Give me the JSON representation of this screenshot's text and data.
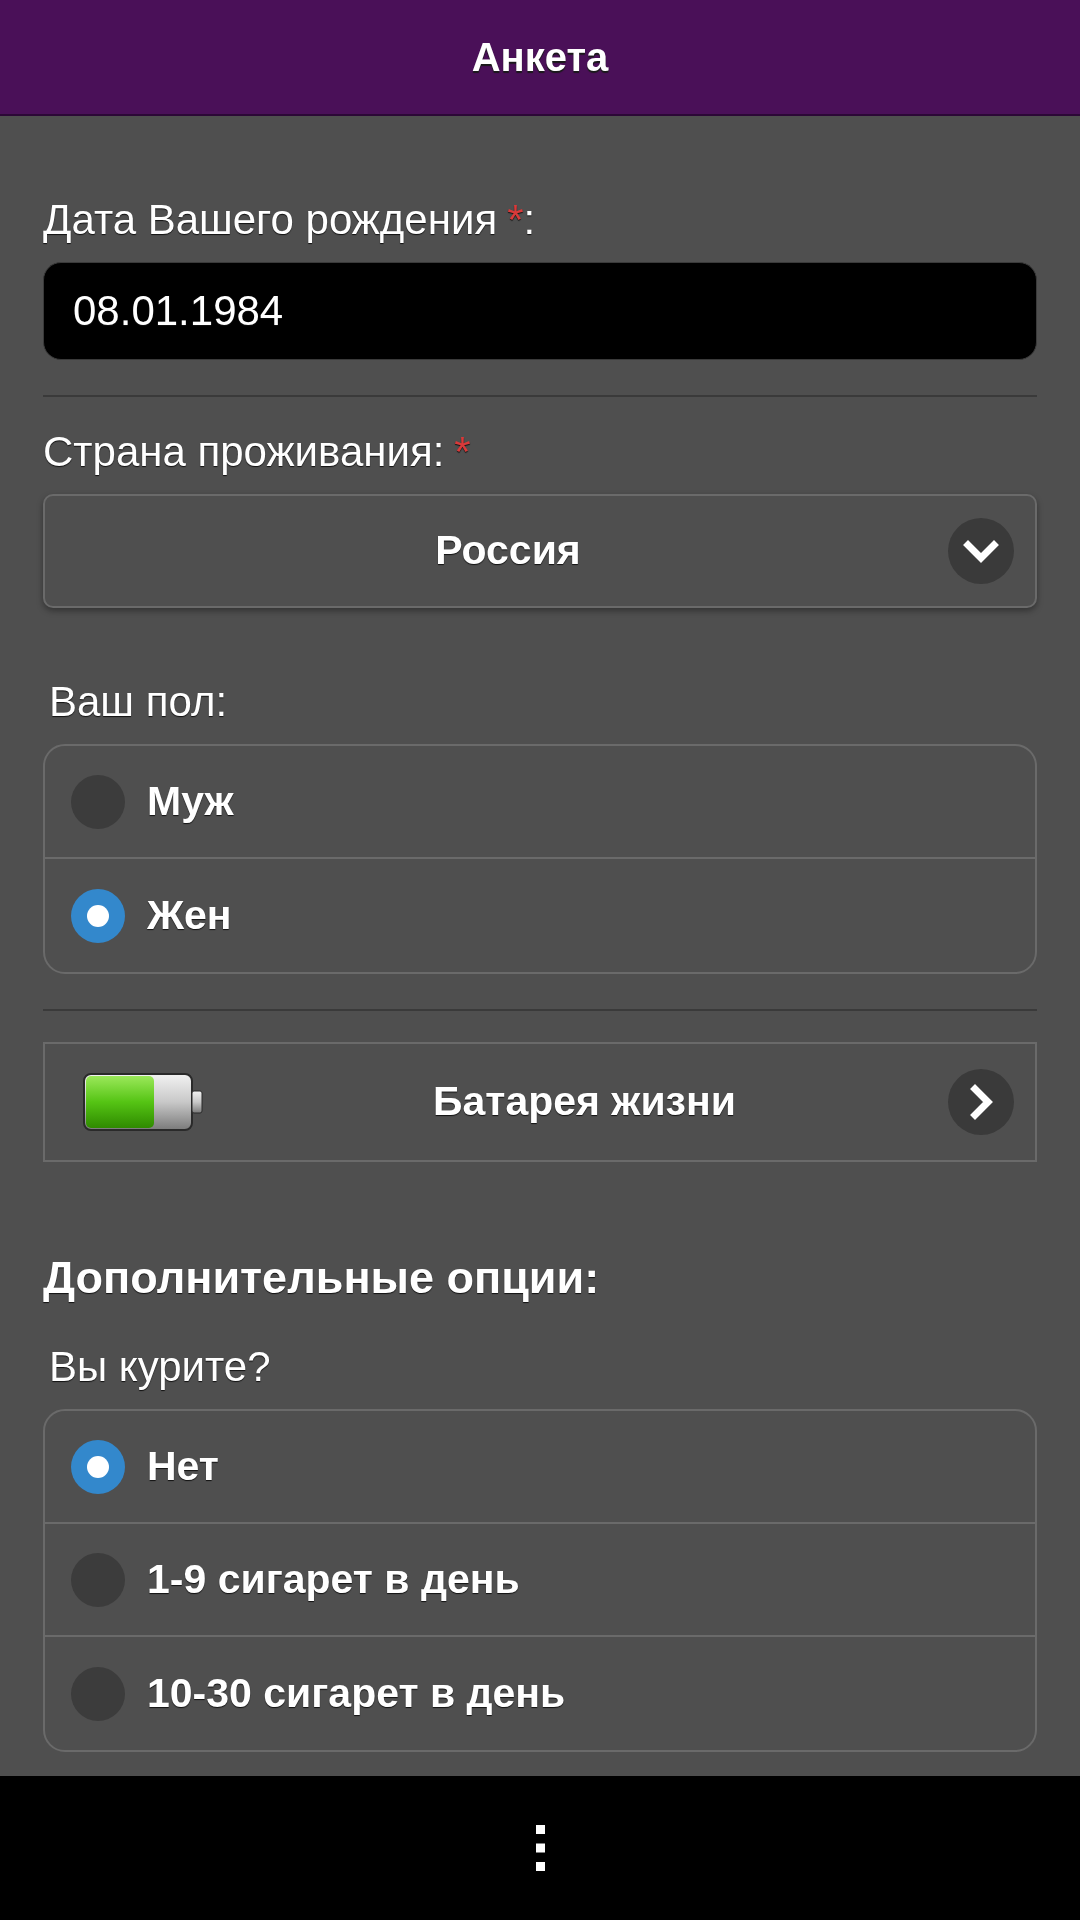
{
  "header": {
    "title": "Анкета"
  },
  "fields": [
    {
      "kind": "date",
      "label": "Дата Вашего рождения",
      "required_mark": "*",
      "label_end": ":",
      "value": "08.01.1984"
    },
    {
      "kind": "divider"
    },
    {
      "kind": "select",
      "label": "Страна проживания:",
      "required_mark": "*",
      "value": "Россия"
    },
    {
      "kind": "radio",
      "label": "Ваш пол:",
      "options": [
        {
          "label": "Муж",
          "selected": false
        },
        {
          "label": "Жен",
          "selected": true
        }
      ]
    },
    {
      "kind": "divider"
    },
    {
      "kind": "link",
      "label": "Батарея жизни"
    },
    {
      "kind": "heading",
      "label": "Дополнительные опции:"
    },
    {
      "kind": "radio",
      "label": "Вы курите?",
      "options": [
        {
          "label": "Нет",
          "selected": true
        },
        {
          "label": "1-9 сигарет в день",
          "selected": false
        },
        {
          "label": "10-30 сигарет в день",
          "selected": false
        }
      ]
    }
  ]
}
